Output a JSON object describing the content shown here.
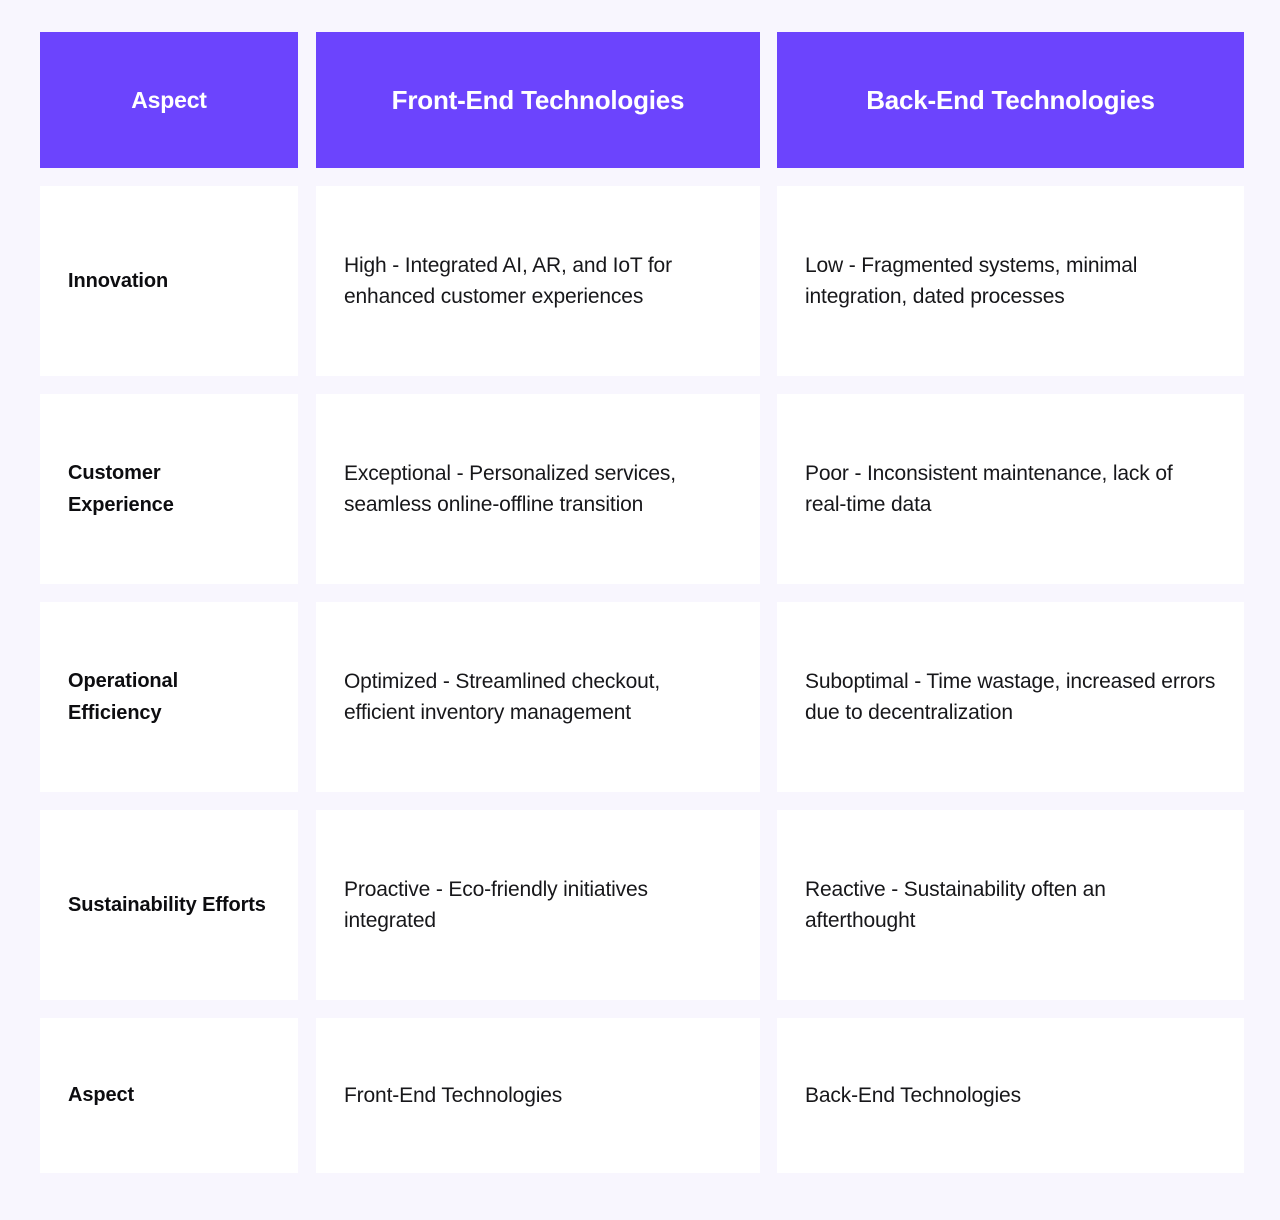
{
  "theme": {
    "page_background": "#f8f6fe",
    "header_background": "#6c44fd",
    "header_text_color": "#ffffff",
    "cell_background": "#ffffff",
    "cell_text_color": "#17171a",
    "aspect_text_color": "#0d0d10"
  },
  "table": {
    "columns": [
      {
        "key": "aspect",
        "label": "Aspect"
      },
      {
        "key": "front_end",
        "label": "Front-End Technologies"
      },
      {
        "key": "back_end",
        "label": "Back-End Technologies"
      }
    ],
    "rows": [
      {
        "aspect": "Innovation",
        "front_end": "High - Integrated AI, AR, and IoT for enhanced customer experiences",
        "back_end": "Low - Fragmented systems, minimal integration, dated processes"
      },
      {
        "aspect": "Customer Experience",
        "front_end": "Exceptional - Personalized services, seamless online-offline transition",
        "back_end": "Poor - Inconsistent maintenance, lack of real-time data"
      },
      {
        "aspect": "Operational Efficiency",
        "front_end": "Optimized - Streamlined checkout, efficient inventory management",
        "back_end": "Suboptimal - Time wastage, increased errors due to decentralization"
      },
      {
        "aspect": "Sustainability Efforts",
        "front_end": "Proactive - Eco-friendly initiatives integrated",
        "back_end": "Reactive - Sustainability often an afterthought"
      },
      {
        "aspect": "Aspect",
        "front_end": "Front-End Technologies",
        "back_end": "Back-End Technologies"
      }
    ]
  }
}
